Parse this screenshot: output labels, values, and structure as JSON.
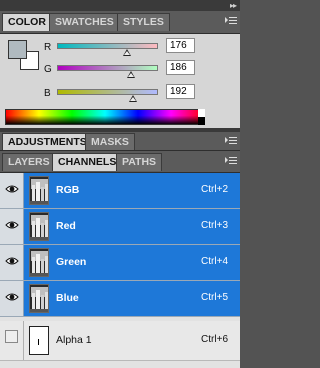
{
  "panel_menu_glyph": "▸▸",
  "color_panel": {
    "tabs": [
      {
        "label": "COLOR",
        "active": true
      },
      {
        "label": "SWATCHES",
        "active": false
      },
      {
        "label": "STYLES",
        "active": false
      }
    ],
    "foreground_color": "#b0bac0",
    "background_color": "#ffffff",
    "sliders": [
      {
        "label": "R",
        "value": "176",
        "fraction": 0.69,
        "gradient_from": "#00bac0",
        "gradient_to": "#ffbac0"
      },
      {
        "label": "G",
        "value": "186",
        "fraction": 0.73,
        "gradient_from": "#b000c0",
        "gradient_to": "#b0ffc0"
      },
      {
        "label": "B",
        "value": "192",
        "fraction": 0.75,
        "gradient_from": "#b0ba00",
        "gradient_to": "#b0baff"
      }
    ]
  },
  "adjust_panel": {
    "tabs": [
      {
        "label": "ADJUSTMENTS",
        "active": true
      },
      {
        "label": "MASKS",
        "active": false
      }
    ]
  },
  "layers_panel": {
    "tabs": [
      {
        "label": "LAYERS",
        "active": false
      },
      {
        "label": "CHANNELS",
        "active": true
      },
      {
        "label": "PATHS",
        "active": false
      }
    ],
    "channels": [
      {
        "name": "RGB",
        "shortcut": "Ctrl+2",
        "selected": true,
        "visible": true
      },
      {
        "name": "Red",
        "shortcut": "Ctrl+3",
        "selected": true,
        "visible": true
      },
      {
        "name": "Green",
        "shortcut": "Ctrl+4",
        "selected": true,
        "visible": true
      },
      {
        "name": "Blue",
        "shortcut": "Ctrl+5",
        "selected": true,
        "visible": true
      },
      {
        "name": "Alpha 1",
        "shortcut": "Ctrl+6",
        "selected": false,
        "visible": false
      }
    ]
  }
}
